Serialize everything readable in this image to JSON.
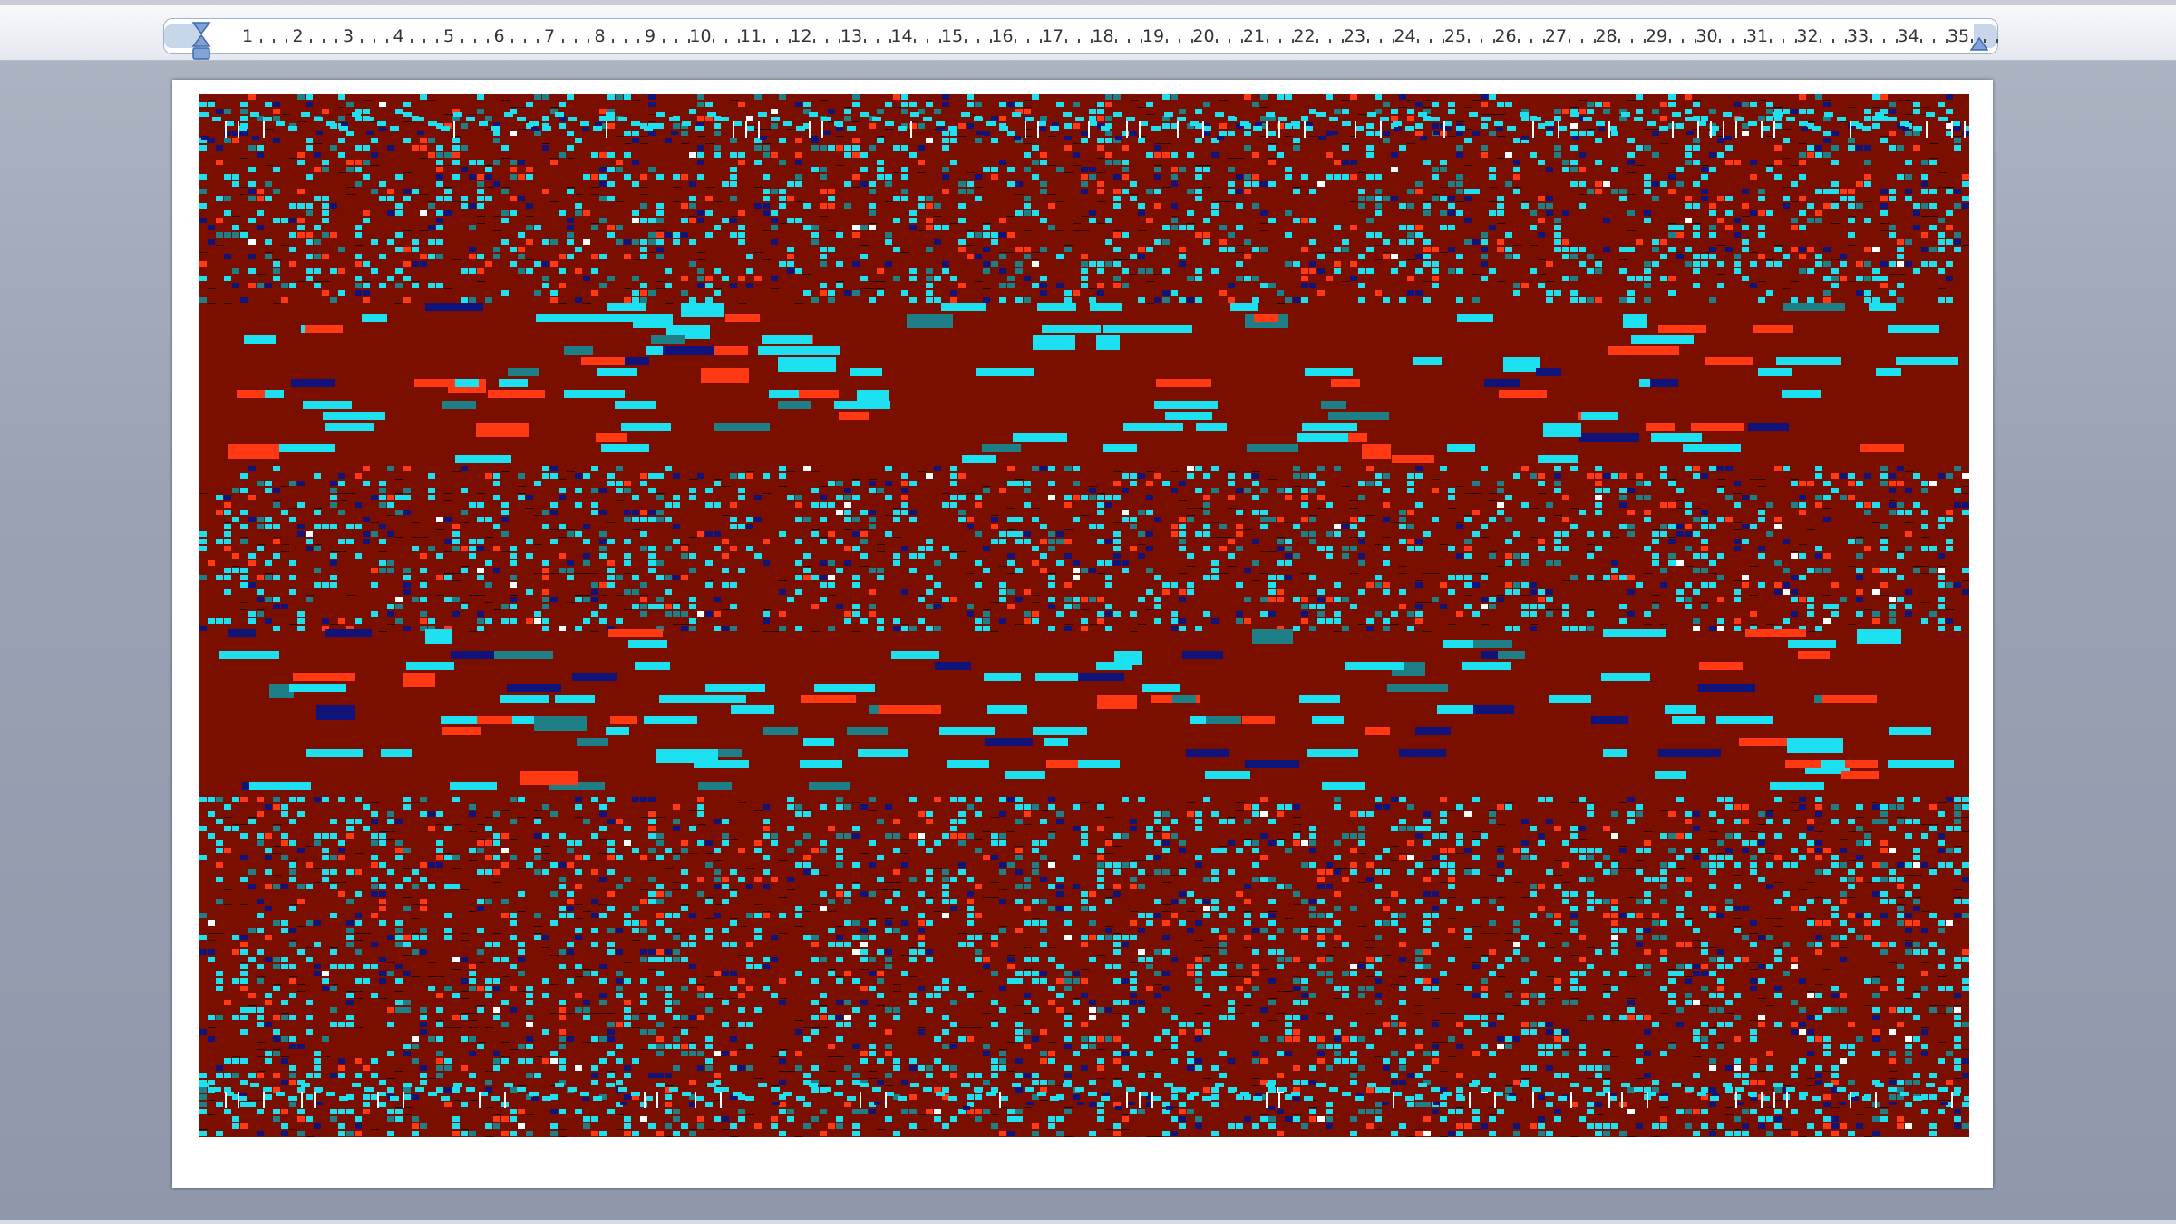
{
  "ruler": {
    "numbers": [
      "1",
      "2",
      "3",
      "4",
      "5",
      "6",
      "7",
      "8",
      "9",
      "10",
      "11",
      "12",
      "13",
      "14",
      "15",
      "16",
      "17",
      "18",
      "19",
      "20",
      "21",
      "22",
      "23",
      "24",
      "25",
      "26",
      "27",
      "28",
      "29",
      "30",
      "31",
      "32",
      "33",
      "34",
      "35"
    ]
  },
  "document": {
    "pattern_colors": {
      "background": "#7a0f00",
      "cyan": "#1de0f0",
      "teal": "#1f7f86",
      "navy": "#10137a",
      "red": "#ff3a12",
      "white": "#ffffff"
    }
  }
}
